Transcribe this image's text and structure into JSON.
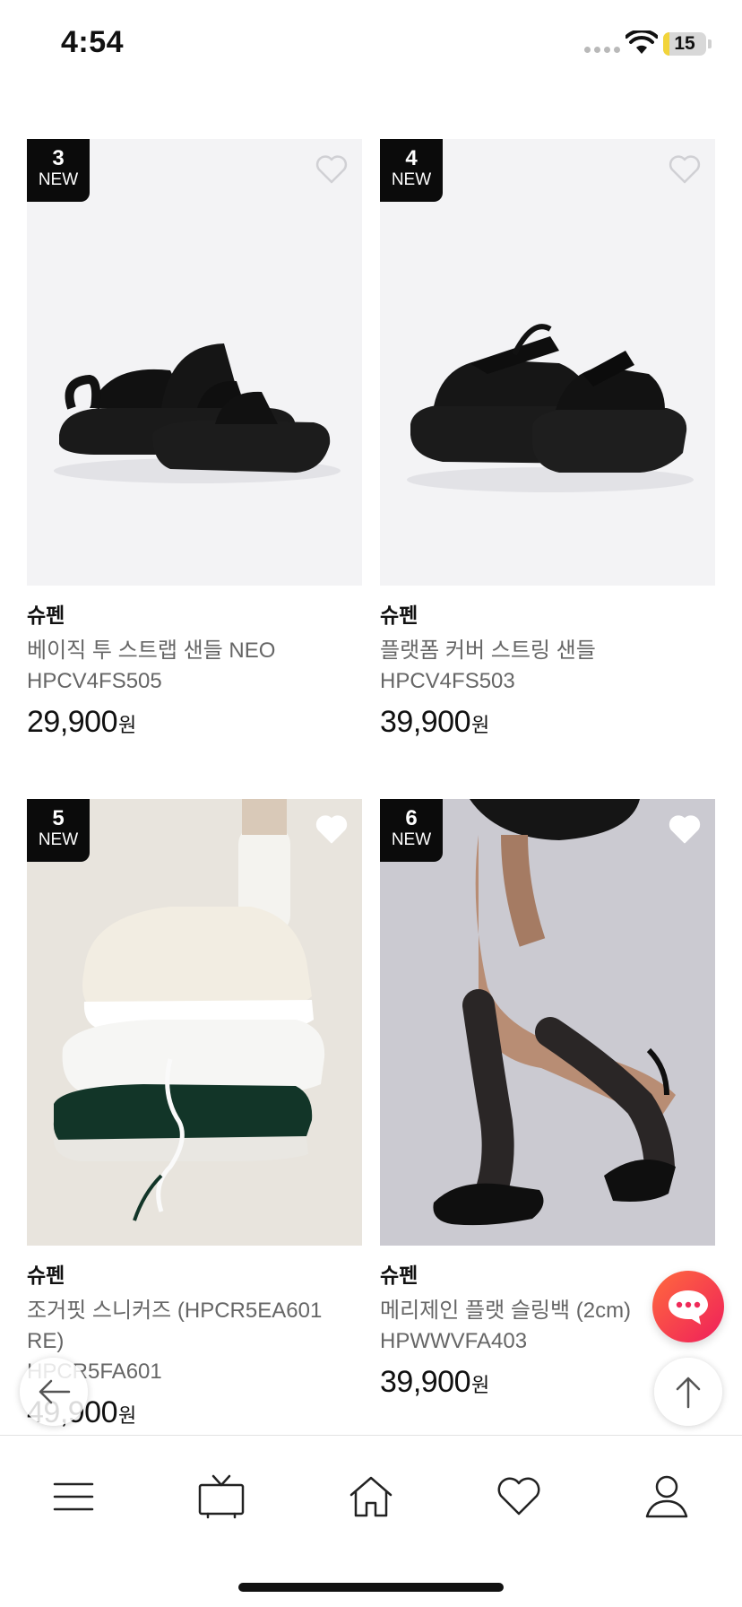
{
  "status_bar": {
    "time": "4:54",
    "battery": "15",
    "battery_level": 0.15
  },
  "products": [
    {
      "rank": "3",
      "tag": "NEW",
      "brand": "슈펜",
      "name": "베이직 투 스트랩 샌들 NEO",
      "code": "HPCV4FS505",
      "price": "29,900",
      "currency": "원",
      "image": "black-two-strap-sandal"
    },
    {
      "rank": "4",
      "tag": "NEW",
      "brand": "슈펜",
      "name": "플랫폼 커버 스트링 샌들",
      "code": "HPCV4FS503",
      "price": "39,900",
      "currency": "원",
      "image": "black-platform-string-sandal"
    },
    {
      "rank": "5",
      "tag": "NEW",
      "brand": "슈펜",
      "name": "조거핏 스니커즈 (HPCR5EA601 RE)",
      "code": "HPCR5FA601",
      "price": "49,900",
      "currency": "원",
      "image": "stacked-jogger-sneakers"
    },
    {
      "rank": "6",
      "tag": "NEW",
      "brand": "슈펜",
      "name": "메리제인 플랫 슬링백 (2cm)",
      "code": "HPWWVFA403",
      "price": "39,900",
      "currency": "원",
      "image": "black-maryjane-slingback"
    }
  ],
  "floating": {
    "chat_icon": "chat-bubble-icon",
    "back_icon": "arrow-left-icon",
    "top_icon": "arrow-up-icon"
  },
  "nav": [
    {
      "icon": "menu-icon"
    },
    {
      "icon": "tv-icon"
    },
    {
      "icon": "home-icon"
    },
    {
      "icon": "heart-icon"
    },
    {
      "icon": "user-icon"
    }
  ],
  "colors": {
    "badge": "#0b0b0b",
    "chat_start": "#ff6a3d",
    "chat_end": "#ef1f5b",
    "text_secondary": "#666666"
  }
}
